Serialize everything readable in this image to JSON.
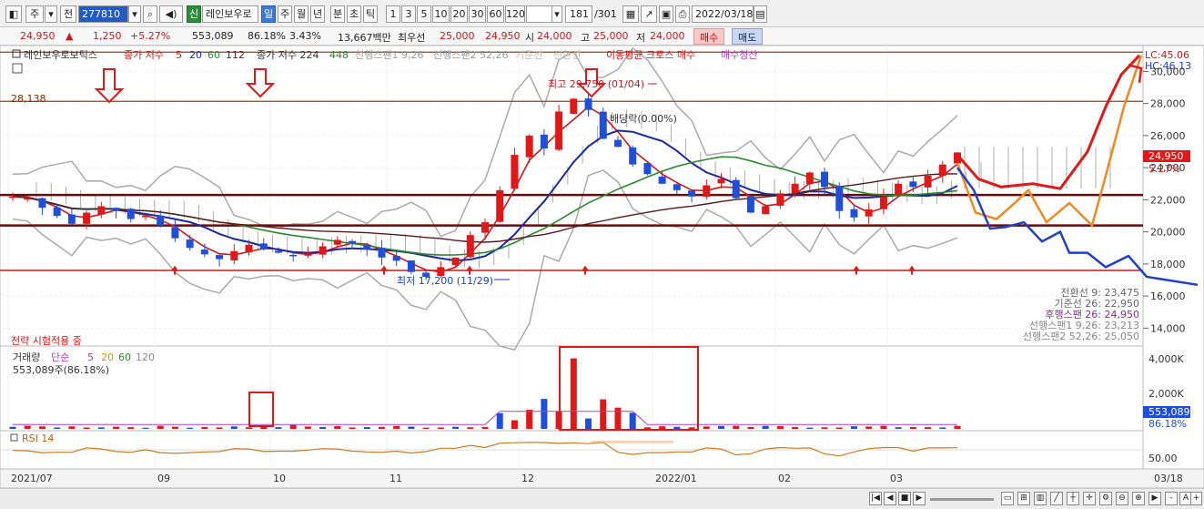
{
  "toolbar": {
    "market_label": "주",
    "prev_label": "전",
    "stock_code": "277810",
    "badge_new": "신",
    "stock_name": "레인보우로",
    "periods": [
      "일",
      "주",
      "월",
      "년",
      "분",
      "초",
      "틱"
    ],
    "intervals": [
      "1",
      "3",
      "5",
      "10",
      "20",
      "30",
      "60",
      "120"
    ],
    "count_value": "181",
    "count_total": "/301",
    "date": "2022/03/18"
  },
  "quote": {
    "price": "24,950",
    "arrow": "▲",
    "change": "1,250",
    "change_pct": "+5.27%",
    "volume": "553,089",
    "vol_ratio": "86.18%",
    "turnover_rate": "3.43%",
    "amount": "13,667백만",
    "best_ask_label": "최우선",
    "best_ask": "25,000",
    "best_bid": "24,950",
    "open_label": "시",
    "open": "24,000",
    "high_label": "고",
    "high": "25,000",
    "low_label": "저",
    "low": "24,000",
    "buy_button": "매수",
    "sell_button": "매도"
  },
  "legend": {
    "name": "레인보우로보틱스",
    "ma_label": "종가 저수",
    "ma_periods": [
      "5",
      "20",
      "60",
      "112"
    ],
    "ma2_label": "종가 저수 224",
    "ma2_value": "448",
    "span1": "선행스팬1 9,26",
    "span2": "선행스팬2 52,26",
    "ichimoku_base": "기준선",
    "ichimoku_conv": "전환선",
    "cross_label": "이동평균 크로스 매수",
    "cross_sell": "매수청산"
  },
  "annotations": {
    "level_left": "28,138",
    "high_note": "최고 29,750 (01/04)",
    "low_note": "최저 17,200 (11/29)",
    "dividend": "배당락(0.00%)",
    "lc": "LC:45.06",
    "hc": "HC:46.13",
    "strategy": "전략 시험적용 중"
  },
  "price_axis": {
    "ticks": [
      "30,000",
      "28,000",
      "26,000",
      "24,000",
      "22,000",
      "20,000",
      "18,000",
      "16,000",
      "14,000"
    ],
    "current": "24,950",
    "current_pct": "5.27%"
  },
  "ichimoku_readout": [
    "전환선 9: 23,475",
    "기준선 26: 22,950",
    "후행스팬 26: 24,950",
    "선행스팬1 9,26: 23,213",
    "선행스팬2 52,26: 25,050"
  ],
  "volume_panel": {
    "label": "거래량",
    "ma_label": "단순",
    "periods": [
      "5",
      "20",
      "60",
      "120"
    ],
    "current_text": "553,089주(86.18%)",
    "axis": [
      "4,000K",
      "2,000K"
    ],
    "current": "553,089",
    "current_pct": "86.18%"
  },
  "rsi_panel": {
    "label": "RSI 14",
    "axis": "50.00"
  },
  "time_axis": [
    "2021/07",
    "09",
    "10",
    "11",
    "12",
    "2022/01",
    "02",
    "03"
  ],
  "time_axis_end": "03/18",
  "colors": {
    "up": "#e01818",
    "down": "#1f4fd8",
    "ma5": "#d01818",
    "ma20": "#1a2aa0",
    "ma60": "#2a8a2a",
    "ma112": "#5a1a1a",
    "bollinger": "#aaaaaa",
    "cloud": "#888888"
  },
  "chart_data": {
    "type": "candlestick",
    "price_range": [
      13000,
      31500
    ],
    "candles_approx_close": [
      22200,
      22100,
      21500,
      21000,
      20500,
      21200,
      21600,
      21300,
      20800,
      21000,
      20400,
      19600,
      19000,
      18600,
      18300,
      18800,
      19200,
      18900,
      18700,
      18500,
      18600,
      19100,
      19500,
      19300,
      18900,
      18400,
      18200,
      17500,
      17200,
      17800,
      18400,
      19800,
      20600,
      22600,
      24800,
      26000,
      25200,
      27500,
      28300,
      27600,
      25800,
      25300,
      24200,
      23600,
      23000,
      22600,
      22200,
      22900,
      23300,
      22100,
      21200,
      21600,
      22400,
      23000,
      23700,
      22800,
      21300,
      20900,
      21400,
      22200,
      23000,
      22800,
      23500,
      24200,
      24950
    ],
    "volume_highlights": [
      "10월 초 거래량 급증",
      "12월~1월 거래량 집중 구간"
    ],
    "horizontal_levels": [
      28138,
      22300,
      20400,
      17600
    ]
  }
}
